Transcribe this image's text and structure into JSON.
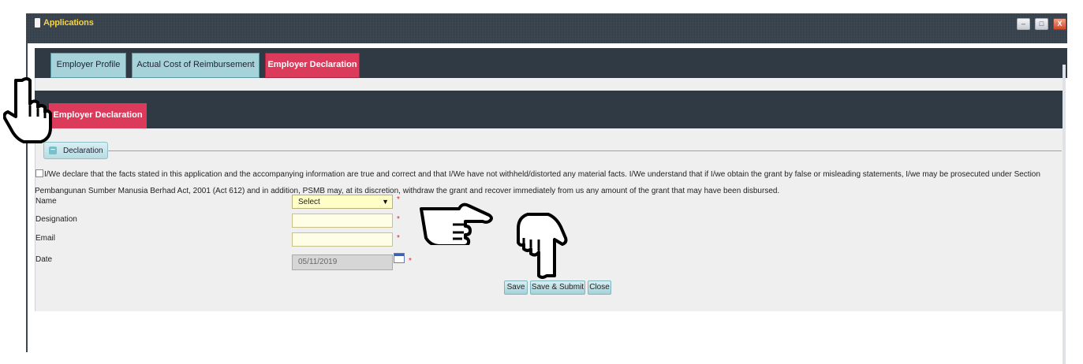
{
  "window": {
    "title": "Applications",
    "minimize_glyph": "–",
    "maximize_glyph": "□",
    "close_glyph": "X"
  },
  "tabs": [
    {
      "label": "Employer Profile",
      "active": false
    },
    {
      "label": "Actual Cost of Reimbursement",
      "active": false
    },
    {
      "label": "Employer Declaration",
      "active": true
    }
  ],
  "section": {
    "subtab_label": "Employer Declaration",
    "fieldset_legend": "Declaration",
    "fieldset_toggle": "−"
  },
  "declaration": {
    "text": "I/We declare that the facts stated in this application and the accompanying information are true and correct and that I/We have not withheld/distorted any material facts. I/We understand that if I/we obtain the grant by false or misleading statements, I/we may be prosecuted under Section Pembangunan Sumber Manusia Berhad Act, 2001 (Act 612) and in addition, PSMB may, at its discretion, withdraw the grant and recover immediately from us any amount of the grant that may have been disbursed.",
    "checked": false
  },
  "form": {
    "name_label": "Name",
    "name_value": "Select",
    "designation_label": "Designation",
    "designation_value": "",
    "email_label": "Email",
    "email_value": "",
    "date_label": "Date",
    "date_value": "05/11/2019",
    "required_mark": "*"
  },
  "buttons": {
    "save": "Save",
    "save_submit": "Save & Submit",
    "close": "Close"
  },
  "colors": {
    "dark_bar": "#2f3a45",
    "active_tab": "#dc3a5a",
    "inactive_tab": "#a6d3da",
    "title_text": "#f3d34a"
  }
}
